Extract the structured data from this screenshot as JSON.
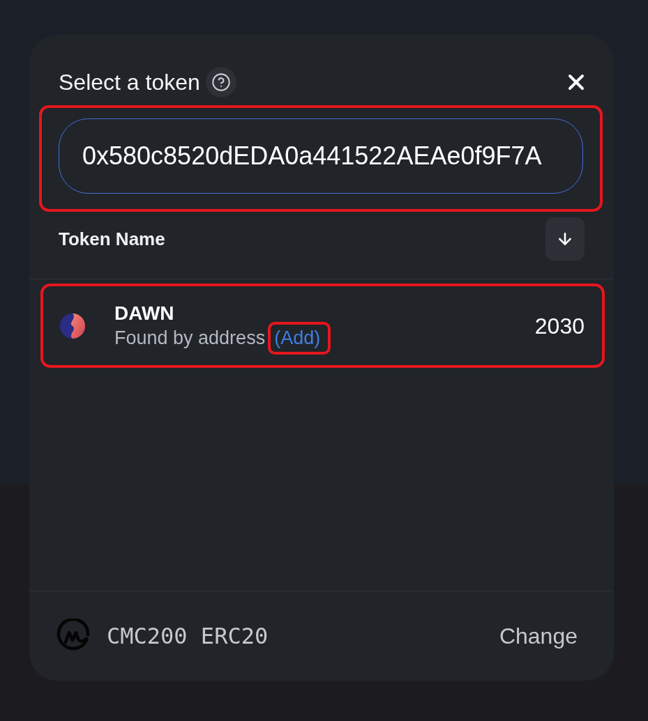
{
  "dialog": {
    "title": "Select a token"
  },
  "search": {
    "value": "0x580c8520dEDA0a441522AEAe0f9F7A",
    "focused": true,
    "highlighted": true
  },
  "list_header": {
    "label": "Token Name",
    "sort_descending": true
  },
  "tokens": [
    {
      "symbol": "DAWN",
      "subtitle": "Found by address",
      "action": {
        "label": "(Add)",
        "highlighted": true
      },
      "balance": "2030",
      "highlighted": true
    }
  ],
  "footer": {
    "list_name": "CMC200 ERC20",
    "button": "Change"
  }
}
